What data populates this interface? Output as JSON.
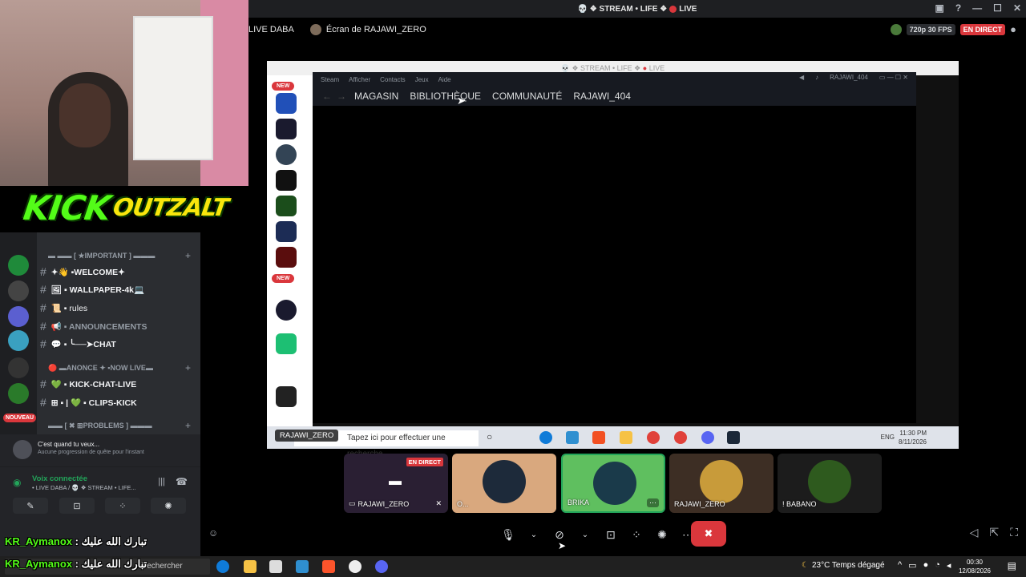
{
  "window": {
    "title_left": "💀 ❖ STREAM • LIFE ❖",
    "title_right": "LIVE",
    "controls": [
      "▣",
      "?",
      "—",
      "☐",
      "✕"
    ]
  },
  "stream_header": {
    "channel": "LIVE DABA",
    "screen_of": "Écran de RAJAWI_ZERO",
    "quality": "720p 30 FPS",
    "live_badge": "EN DIRECT"
  },
  "kick_logo": {
    "main": "KICK",
    "sub": "OUTZALT"
  },
  "channels": {
    "items": [
      {
        "type": "category",
        "label": "▬ ▬▬ [ ★IMPORTANT ] ▬▬▬"
      },
      {
        "type": "channel",
        "label": "✦👋 ▪WELCOME✦"
      },
      {
        "type": "channel",
        "label": "🖼 ▪ WALLPAPER-4k💻"
      },
      {
        "type": "channel",
        "label": "📜 ▪ rules"
      },
      {
        "type": "channel",
        "label": "📢 ▪ ANNOUNCEMENTS"
      },
      {
        "type": "channel",
        "label": "💬 ▪ ╰──➤CHAT"
      },
      {
        "type": "category",
        "label": "🔴 ▬ANONCE ✦ ▪NOW LIVE▬"
      },
      {
        "type": "channel",
        "label": "💚 ▪ KICK-CHAT-LIVE"
      },
      {
        "type": "channel",
        "label": "⊞ ▪ | 💚 ▪ CLIPS-KICK"
      },
      {
        "type": "category",
        "label": "▬▬ [ ✖ ⊞PROBLEMS ] ▬▬▬"
      }
    ],
    "nouveau_badge": "NOUVEAU"
  },
  "quest": {
    "title": "C'est quand tu veux...",
    "subtitle": "Aucune progression de quête pour l'instant"
  },
  "voice": {
    "status": "Voix connectée",
    "location": "• LIVE DABA / 💀 ❖ STREAM • LIFE...",
    "buttons": [
      "✎",
      "⊡",
      "⁘",
      "✺"
    ]
  },
  "overlay_chat": {
    "name": "KR_Aymanox",
    "message": " : تبارك الله عليك"
  },
  "shared_window": {
    "title": "💀 ❖ STREAM • LIFE ❖",
    "title_live": "LIVE",
    "sidebar_new": "NEW",
    "steam_menu": [
      "Steam",
      "Afficher",
      "Contacts",
      "Jeux",
      "Aide"
    ],
    "steam_nav": [
      "MAGASIN",
      "BIBLIOTHÈQUE",
      "COMMUNAUTÉ",
      "RAJAWI_404"
    ],
    "steam_user": "RAJAWI_404",
    "search_placeholder": "Tapez ici pour effectuer une recherche",
    "tag": "RAJAWI_ZERO",
    "lang": "ENG",
    "clock_time": "11:30 PM",
    "clock_date": "8/11/2026"
  },
  "tiles": [
    {
      "label": "RAJAWI_ZERO",
      "badge": "EN DIRECT",
      "color": "#3a2a45"
    },
    {
      "label": "O...",
      "color": "#d9a87e"
    },
    {
      "label": "BRIKA",
      "color": "#5fbf5f"
    },
    {
      "label": "RAJAWI_ZERO",
      "color": "#3d2e24"
    },
    {
      "label": "! BABANO",
      "color": "#1c1c1c"
    }
  ],
  "taskbar": {
    "search": "Rechercher",
    "weather": "23°C  Temps dégagé",
    "time": "00:30",
    "date": "12/08/2026"
  },
  "colors": {
    "discord_green": "#23a55a",
    "discord_red": "#da373c",
    "kick_green": "#53fc18"
  }
}
